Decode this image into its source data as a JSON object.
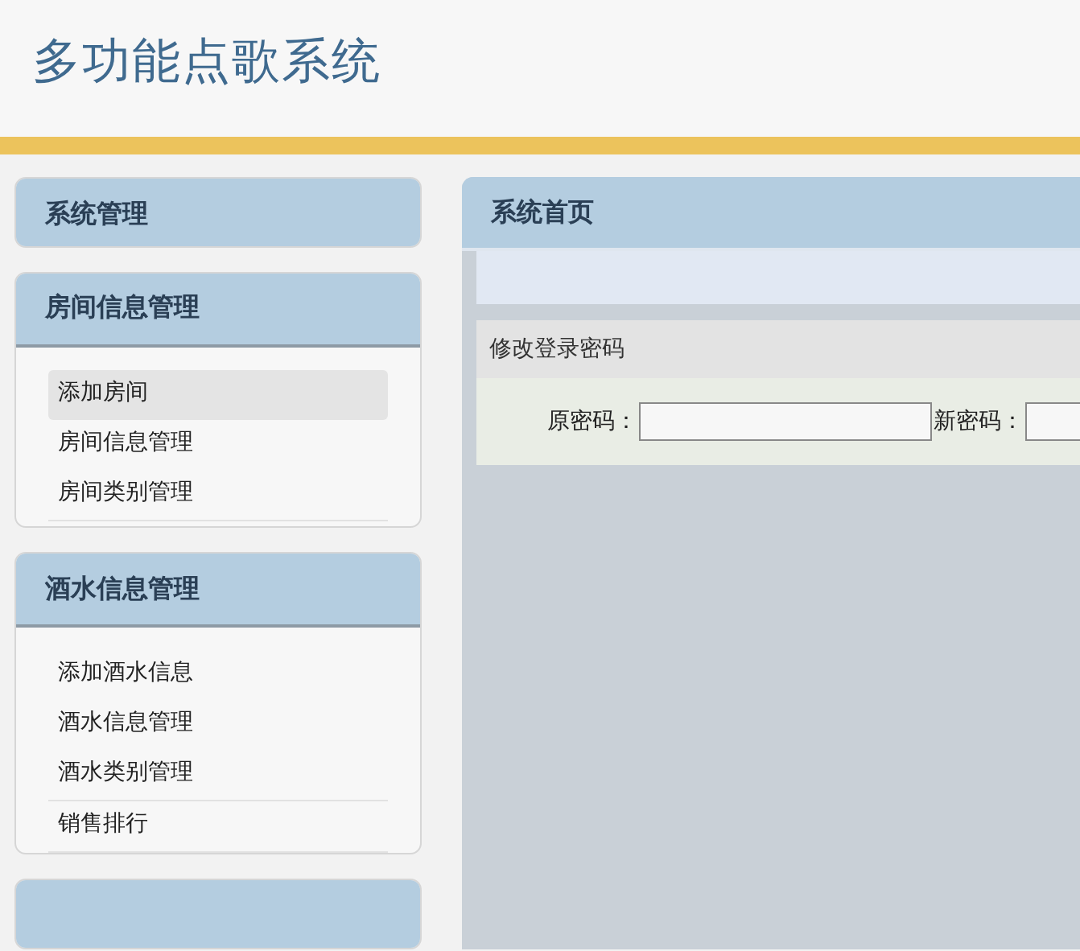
{
  "header": {
    "title": "多功能点歌系统"
  },
  "sidebar": {
    "sections": [
      {
        "title": "系统管理"
      },
      {
        "title": "房间信息管理",
        "items": [
          {
            "label": "添加房间",
            "selected": true
          },
          {
            "label": "房间信息管理",
            "selected": false
          },
          {
            "label": "房间类别管理",
            "selected": false
          }
        ]
      },
      {
        "title": "酒水信息管理",
        "items": [
          {
            "label": "添加酒水信息",
            "selected": false
          },
          {
            "label": "酒水信息管理",
            "selected": false
          },
          {
            "label": "酒水类别管理",
            "selected": false
          },
          {
            "label": "销售排行",
            "selected": false
          }
        ]
      }
    ]
  },
  "main": {
    "title": "系统首页",
    "form": {
      "title": "修改登录密码",
      "fields": [
        {
          "label": "原密码："
        },
        {
          "label": "新密码："
        }
      ]
    }
  }
}
